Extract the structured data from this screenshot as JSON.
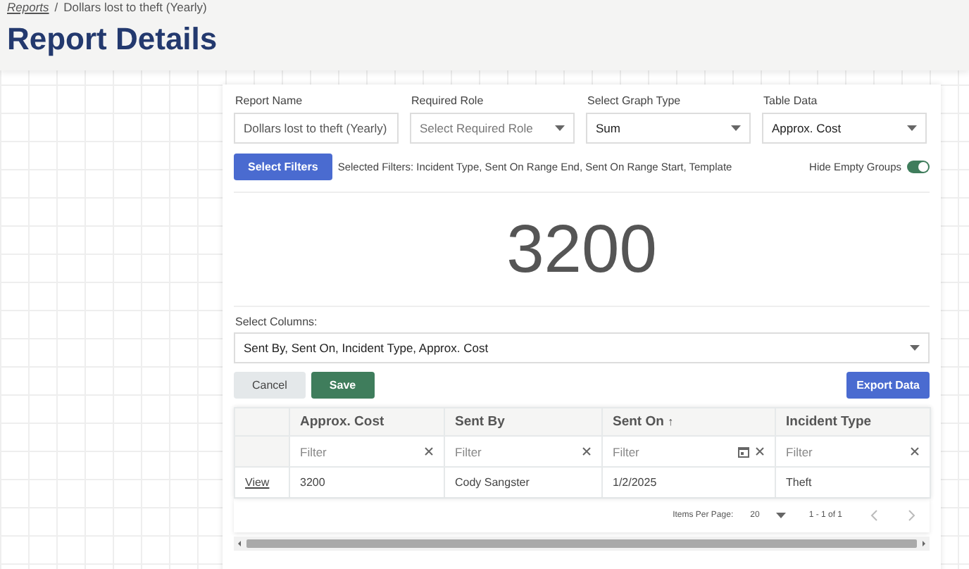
{
  "breadcrumb": [
    {
      "label": "Reports",
      "kind": "link"
    },
    {
      "label": "Dollars lost to theft (Yearly)",
      "kind": "current"
    }
  ],
  "breadcrumb_separator": "/",
  "page_title": "Report Details",
  "fields": [
    {
      "label": "Report Name",
      "kind": "input",
      "value": "Dollars lost to theft (Yearly)"
    },
    {
      "label": "Required Role",
      "kind": "select",
      "placeholder": "Select Required Role"
    },
    {
      "label": "Select Graph Type",
      "kind": "select",
      "value": "Sum"
    },
    {
      "label": "Table Data",
      "kind": "select",
      "value": "Approx. Cost"
    }
  ],
  "filters_button": "Select Filters",
  "selected_filters": "Selected Filters: Incident Type, Sent On Range End, Sent On Range Start, Template",
  "hide_empty_groups": {
    "label": "Hide Empty Groups",
    "on": true
  },
  "total": "3200",
  "columns_select": {
    "label": "Select Columns:",
    "value": "Sent By, Sent On, Incident Type, Approx. Cost"
  },
  "buttons": [
    {
      "label": "Cancel",
      "kind": "secondary"
    },
    {
      "label": "Save",
      "kind": "primary"
    },
    {
      "label": "Export Data",
      "kind": "export"
    }
  ],
  "table": {
    "columns": [
      {
        "label": "Approx. Cost",
        "filter": {
          "placeholder": "Filter",
          "kind": "text"
        }
      },
      {
        "label": "Sent By",
        "filter": {
          "placeholder": "Filter",
          "kind": "text"
        }
      },
      {
        "label": "Sent On",
        "sort_mark": "↑",
        "filter": {
          "placeholder": "Filter",
          "kind": "date"
        }
      },
      {
        "label": "Incident Type",
        "filter": {
          "placeholder": "Filter",
          "kind": "text"
        }
      }
    ],
    "rows": [
      {
        "action": "View",
        "cells": [
          "3200",
          "Cody Sangster",
          "1/2/2025",
          "Theft"
        ]
      }
    ],
    "pagination": {
      "items_per_page_label": "Items Per Page:",
      "items_per_page": "20",
      "range": "1 - 1 of 1"
    }
  }
}
